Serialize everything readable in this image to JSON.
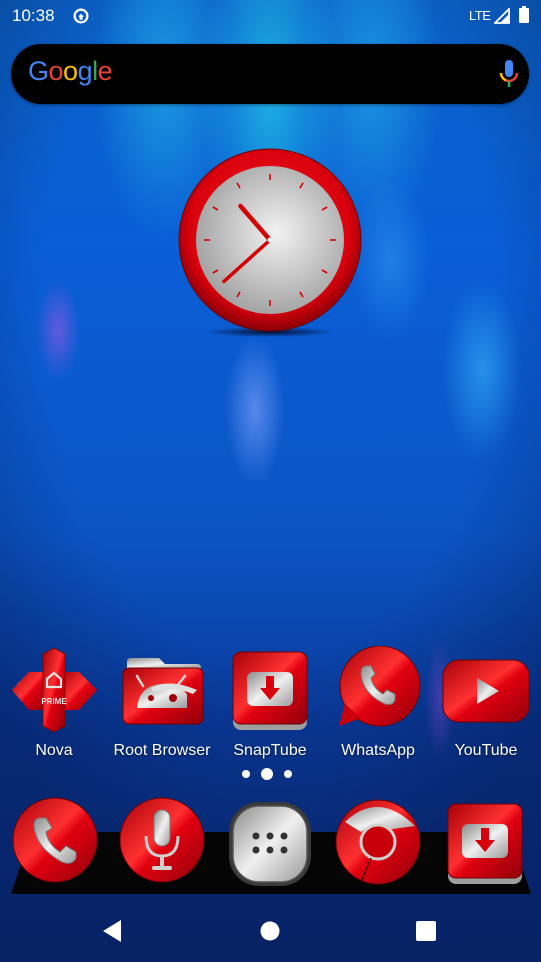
{
  "status_bar": {
    "time": "10:38",
    "sync_icon": "data-saver-icon",
    "network": "LTE",
    "signal_icon": "signal-icon",
    "battery_icon": "battery-icon"
  },
  "search": {
    "logo_letters": [
      {
        "char": "G",
        "color": "#4285F4"
      },
      {
        "char": "o",
        "color": "#EA4335"
      },
      {
        "char": "o",
        "color": "#FBBC05"
      },
      {
        "char": "g",
        "color": "#4285F4"
      },
      {
        "char": "l",
        "color": "#34A853"
      },
      {
        "char": "e",
        "color": "#EA4335"
      }
    ],
    "mic_icon": "mic-icon"
  },
  "clock_widget": {
    "hour": 10,
    "minute": 38,
    "rim_color": "#d8000c",
    "face_color": "#bdbdbd",
    "hand_color": "#d50000"
  },
  "home_apps": [
    {
      "label": "Nova",
      "icon": "nova-prime-icon",
      "badge_text": "PRIME"
    },
    {
      "label": "Root Browser",
      "icon": "root-browser-icon"
    },
    {
      "label": "SnapTube",
      "icon": "snaptube-icon"
    },
    {
      "label": "WhatsApp",
      "icon": "whatsapp-icon"
    },
    {
      "label": "YouTube",
      "icon": "youtube-icon"
    }
  ],
  "page_indicator": {
    "pages": 3,
    "current": 2
  },
  "dock": [
    {
      "name": "phone",
      "icon": "phone-icon"
    },
    {
      "name": "voice-search",
      "icon": "mic-icon"
    },
    {
      "name": "app-drawer",
      "icon": "app-drawer-icon"
    },
    {
      "name": "chrome",
      "icon": "chrome-icon"
    },
    {
      "name": "snaptube",
      "icon": "snaptube-icon"
    }
  ],
  "nav_bar": {
    "back": "back-icon",
    "home": "home-icon",
    "recents": "recents-icon"
  },
  "theme": {
    "accent_red": "#d8000c",
    "silver": "#c8c8c8",
    "wallpaper_blue": "#0b55c6"
  }
}
